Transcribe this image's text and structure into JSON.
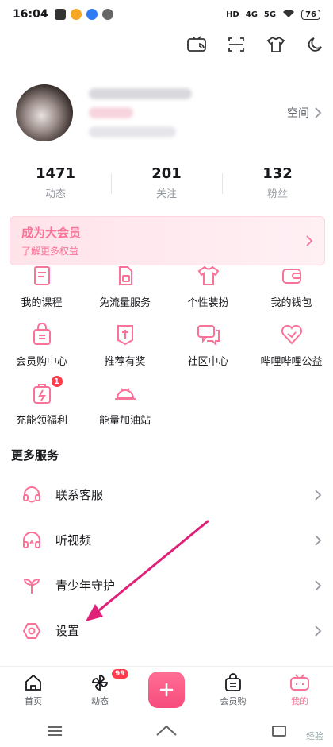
{
  "status_bar": {
    "time": "16:04",
    "network_1": "4G",
    "network_2": "5G",
    "battery": "76"
  },
  "profile": {
    "space_label": "空间"
  },
  "stats": [
    {
      "value": "1471",
      "label": "动态"
    },
    {
      "value": "201",
      "label": "关注"
    },
    {
      "value": "132",
      "label": "粉丝"
    }
  ],
  "vip_banner": {
    "title": "成为大会员",
    "subtitle": "了解更多权益"
  },
  "services": [
    {
      "label": "我的课程",
      "icon": "course-icon"
    },
    {
      "label": "免流量服务",
      "icon": "sim-card-icon"
    },
    {
      "label": "个性装扮",
      "icon": "tshirt-icon"
    },
    {
      "label": "我的钱包",
      "icon": "wallet-icon"
    },
    {
      "label": "会员购中心",
      "icon": "shopping-bag-icon"
    },
    {
      "label": "推荐有奖",
      "icon": "reward-icon"
    },
    {
      "label": "社区中心",
      "icon": "community-icon"
    },
    {
      "label": "哔哩哔哩公益",
      "icon": "heart-icon"
    },
    {
      "label": "充能领福利",
      "icon": "battery-gift-icon",
      "badge": "1"
    },
    {
      "label": "能量加油站",
      "icon": "energy-station-icon"
    }
  ],
  "more_services": {
    "title": "更多服务",
    "items": [
      {
        "label": "联系客服",
        "icon": "headset-icon"
      },
      {
        "label": "听视频",
        "icon": "headphones-icon"
      },
      {
        "label": "青少年守护",
        "icon": "sprout-icon"
      },
      {
        "label": "设置",
        "icon": "settings-icon"
      }
    ]
  },
  "tabbar": [
    {
      "label": "首页",
      "icon": "home-icon"
    },
    {
      "label": "动态",
      "icon": "pinwheel-icon",
      "badge": "99"
    },
    {
      "label": "",
      "icon": "plus-icon"
    },
    {
      "label": "会员购",
      "icon": "shopping-bag-icon"
    },
    {
      "label": "我的",
      "icon": "tv-icon",
      "active": true
    }
  ],
  "watermark": "经验",
  "colors": {
    "accent": "#fb7299",
    "badge": "#ff3b4e",
    "annotation_arrow": "#e0217a"
  }
}
